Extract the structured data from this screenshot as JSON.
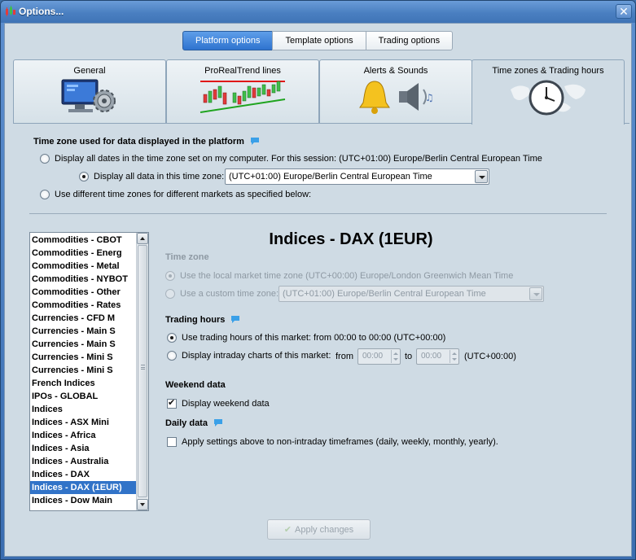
{
  "window": {
    "title": "Options...",
    "close_glyph": "✕"
  },
  "top_tabs": [
    {
      "label": "Platform options",
      "active": true
    },
    {
      "label": "Template options",
      "active": false
    },
    {
      "label": "Trading options",
      "active": false
    }
  ],
  "category_tabs": [
    {
      "label": "General",
      "icon": "monitor-gear-icon"
    },
    {
      "label": "ProRealTrend lines",
      "icon": "trend-chart-icon"
    },
    {
      "label": "Alerts & Sounds",
      "icon": "bell-speaker-icon"
    },
    {
      "label": "Time zones & Trading hours",
      "icon": "clock-world-icon",
      "active": true
    }
  ],
  "timezone_section": {
    "heading": "Time zone used for data displayed in the platform",
    "option_computer": "Display all dates in the time zone set on my computer. For this session: (UTC+01:00) Europe/Berlin Central European Time",
    "option_this_zone": "Display all data in this time zone:",
    "zone_select_value": "(UTC+01:00) Europe/Berlin Central European Time",
    "option_different": "Use different time zones for different markets as specified below:",
    "selected": "this_zone"
  },
  "markets": {
    "items": [
      "Commodities - CBOT",
      "Commodities - Energ",
      "Commodities - Metal",
      "Commodities - NYBOT",
      "Commodities - Other",
      "Commodities - Rates",
      "Currencies - CFD M",
      "Currencies - Main S",
      "Currencies - Main S",
      "Currencies - Mini S",
      "Currencies - Mini S",
      "French Indices",
      "IPOs - GLOBAL",
      "Indices",
      "Indices - ASX Mini",
      "Indices - Africa",
      "Indices - Asia",
      "Indices - Australia",
      "Indices - DAX",
      "Indices - DAX (1EUR)",
      "Indices - Dow Main"
    ],
    "selected_index": 19
  },
  "market_detail": {
    "title": "Indices - DAX (1EUR)",
    "timezone_heading": "Time zone",
    "use_local": "Use the local market time zone (UTC+00:00) Europe/London Greenwich Mean Time",
    "use_custom": "Use a custom time zone:",
    "custom_value": "(UTC+01:00) Europe/Berlin Central European Time",
    "trading_hours_heading": "Trading hours",
    "use_market_hours": "Use trading hours of this market: from 00:00 to 00:00  (UTC+00:00)",
    "intraday_label": "Display intraday charts of this market:",
    "from_label": "from",
    "from_value": "00:00",
    "to_label": "to",
    "to_value": "00:00",
    "tz_suffix": "(UTC+00:00)",
    "weekend_heading": "Weekend data",
    "weekend_label": "Display weekend data",
    "weekend_checked": true,
    "daily_heading": "Daily data",
    "daily_label": "Apply settings above to non-intraday timeframes (daily, weekly, monthly, yearly).",
    "daily_checked": false
  },
  "apply_button": "Apply changes",
  "colors": {
    "accent": "#3173c8",
    "panel": "#cfdbe4",
    "help_icon": "#3aa0e8"
  }
}
